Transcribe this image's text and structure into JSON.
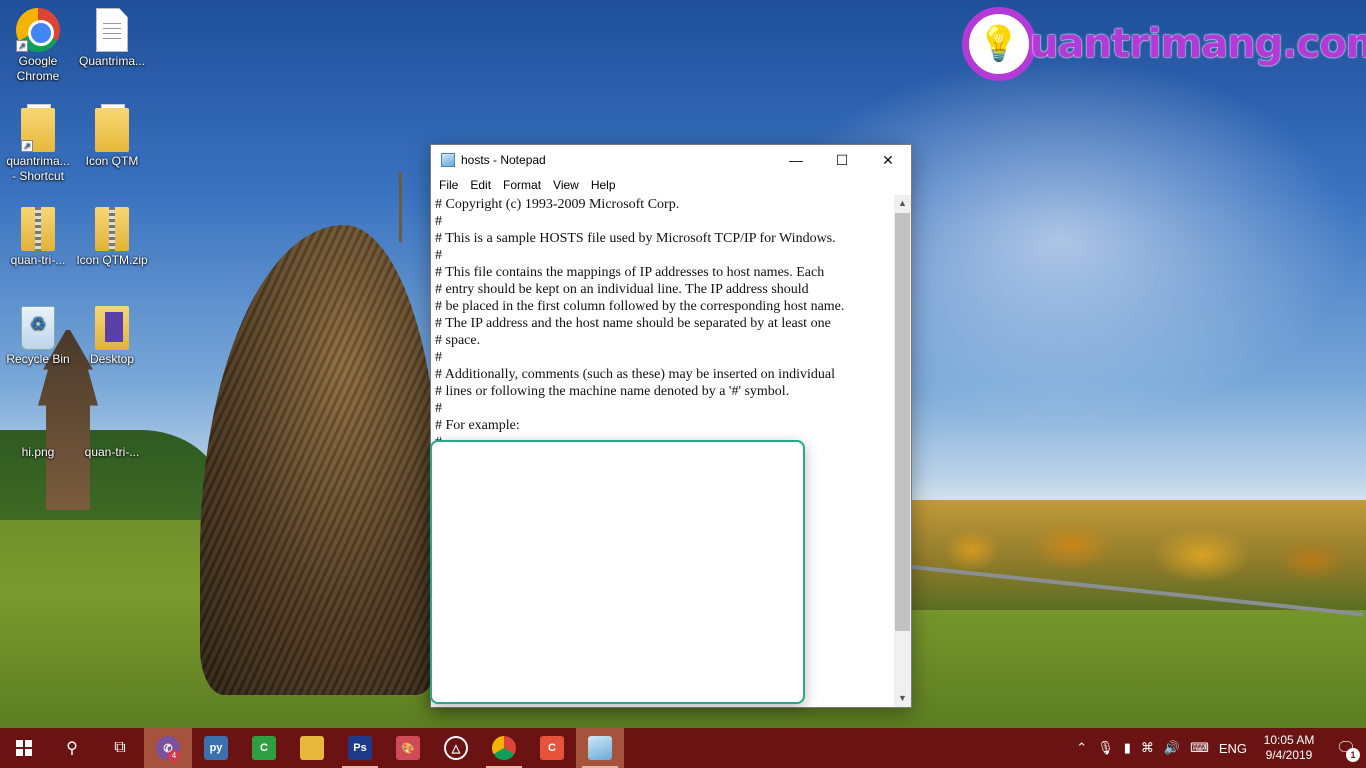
{
  "desktop": {
    "icons": [
      {
        "label": "Google\nChrome",
        "l1": "Google",
        "l2": "Chrome"
      },
      {
        "l1": "Quantrima..."
      },
      {
        "l1": "quantrima...",
        "l2": "- Shortcut"
      },
      {
        "l1": "Icon QTM"
      },
      {
        "l1": "quan-tri-..."
      },
      {
        "l1": "Icon QTM.zip"
      },
      {
        "l1": "Recycle Bin"
      },
      {
        "l1": "Desktop"
      },
      {
        "l1": "hi.png"
      },
      {
        "l1": "quan-tri-..."
      }
    ],
    "watermark": "uantrimang.com"
  },
  "notepad": {
    "title": "hosts - Notepad",
    "menu": [
      "File",
      "Edit",
      "Format",
      "View",
      "Help"
    ],
    "lines": [
      "# Copyright (c) 1993-2009 Microsoft Corp.",
      "#",
      "# This is a sample HOSTS file used by Microsoft TCP/IP for Windows.",
      "#",
      "# This file contains the mappings of IP addresses to host names. Each",
      "# entry should be kept on an individual line. The IP address should",
      "# be placed in the first column followed by the corresponding host name.",
      "# The IP address and the host name should be separated by at least one",
      "# space.",
      "#",
      "# Additionally, comments (such as these) may be inserted on individual",
      "# lines or following the machine name denoted by a '#' symbol.",
      "#",
      "# For example:",
      "#"
    ]
  },
  "taskbar": {
    "viber_badge": "4",
    "language": "ENG",
    "time": "10:05 AM",
    "date": "9/4/2019",
    "notification_count": "1",
    "apps": [
      {
        "name": "Ps",
        "color": "#1f3a8a"
      },
      {
        "name": "C",
        "color": "#e5533a"
      }
    ]
  },
  "colors": {
    "taskbar": "#6b1313",
    "active_app": "#a5533c",
    "overlay_border": "#27a889",
    "logo": "#b43ad8"
  }
}
